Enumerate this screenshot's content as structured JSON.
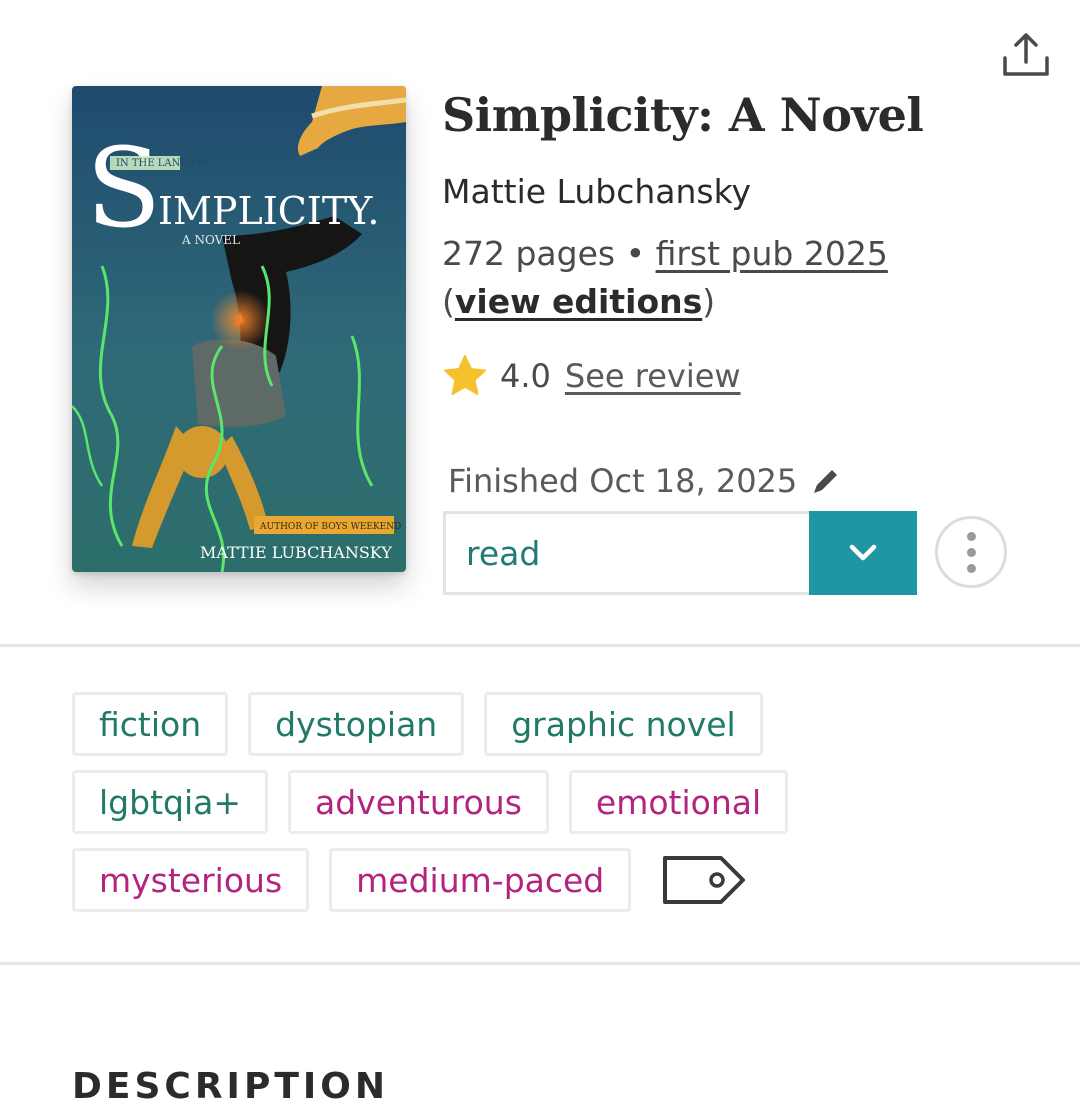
{
  "book": {
    "title": "Simplicity: A Novel",
    "author": "Mattie Lubchansky",
    "pages": "272 pages",
    "separator": "•",
    "first_pub": "first pub 2025",
    "view_editions": "view editions",
    "open_paren": "(",
    "close_paren": ")"
  },
  "cover": {
    "top_line": "IN THE LAND OF...",
    "big_initial": "S",
    "title_text": "IMPLICITY.",
    "subtitle": "A NOVEL",
    "badge": "AUTHOR OF BOYS WEEKEND",
    "author_text": "MATTIE LUBCHANSKY"
  },
  "rating": {
    "value": "4.0",
    "see_review": "See review",
    "star_color": "#f6c12e"
  },
  "reading": {
    "finished": "Finished Oct 18, 2025",
    "status": "read"
  },
  "tags": {
    "row1": [
      "fiction",
      "dystopian",
      "graphic novel"
    ],
    "row2_genre": [
      "lgbtqia+"
    ],
    "row2_mood": [
      "adventurous",
      "emotional"
    ],
    "row3_mood": [
      "mysterious",
      "medium-paced"
    ]
  },
  "section": {
    "heading": "DESCRIPTION"
  },
  "colors": {
    "accent": "#1f97a3",
    "genre_tag": "#1f7a68",
    "mood_tag": "#b3247f"
  },
  "icons": {
    "share": "share-icon",
    "edit": "pencil-icon",
    "dropdown": "chevron-down-icon",
    "more": "more-vertical-icon",
    "tag": "tag-icon",
    "star": "star-icon"
  }
}
